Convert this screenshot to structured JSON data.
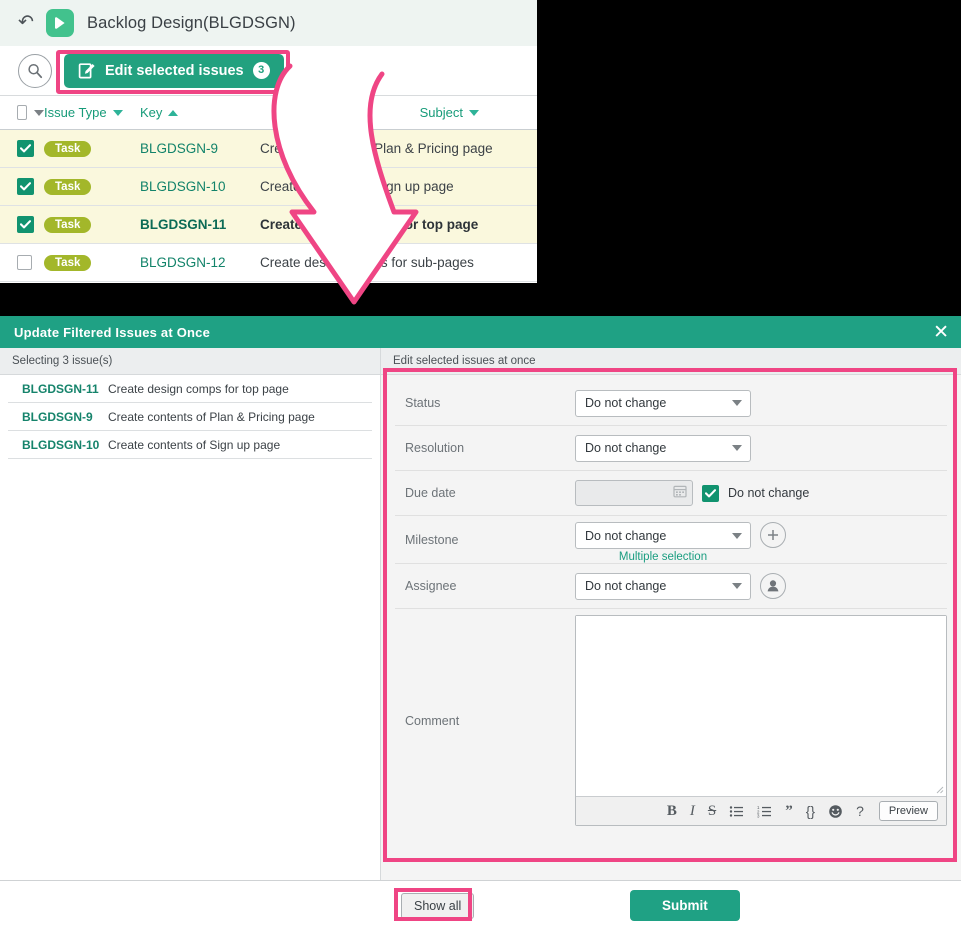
{
  "app": {
    "back_icon": "back-arrow-icon",
    "logo_icon": "backlog-logo-icon",
    "title": "Backlog Design(BLGDSGN)",
    "search_icon": "search-icon",
    "edit_button": {
      "label": "Edit selected issues",
      "count": "3",
      "icon": "edit-document-icon"
    }
  },
  "issue_table": {
    "headers": {
      "checkbox": "",
      "issue_type": "Issue Type",
      "key": "Key",
      "subject": "Subject"
    },
    "rows": [
      {
        "checked": "true",
        "type": "Task",
        "key": "BLGDSGN-9",
        "subject": "Create contents of Plan & Pricing page"
      },
      {
        "checked": "true",
        "type": "Task",
        "key": "BLGDSGN-10",
        "subject": "Create contents of Sign up page"
      },
      {
        "checked": "true",
        "type": "Task",
        "key": "BLGDSGN-11",
        "subject": "Create design comps for top page"
      },
      {
        "checked": "false",
        "type": "Task",
        "key": "BLGDSGN-12",
        "subject": "Create design comps for sub-pages"
      }
    ]
  },
  "dialog": {
    "title": "Update Filtered Issues at Once",
    "close_icon": "close-icon",
    "left": {
      "subheader": "Selecting 3 issue(s)",
      "items": [
        {
          "key": "BLGDSGN-11",
          "subject": "Create design comps for top page"
        },
        {
          "key": "BLGDSGN-9",
          "subject": "Create contents of Plan & Pricing page"
        },
        {
          "key": "BLGDSGN-10",
          "subject": "Create contents of Sign up page"
        }
      ]
    },
    "right": {
      "subheader": "Edit selected issues at once",
      "fields": {
        "status": {
          "label": "Status",
          "value": "Do not change"
        },
        "resolution": {
          "label": "Resolution",
          "value": "Do not change"
        },
        "due_date": {
          "label": "Due date",
          "value": "",
          "checkbox_label": "Do not change",
          "checked": "true",
          "calendar_icon": "calendar-icon"
        },
        "milestone": {
          "label": "Milestone",
          "value": "Do not change",
          "helper": "Multiple selection",
          "add_icon": "plus-icon"
        },
        "assignee": {
          "label": "Assignee",
          "value": "Do not change",
          "avatar_icon": "user-silhouette-icon"
        },
        "comment": {
          "label": "Comment",
          "value": "",
          "placeholder": ""
        }
      },
      "comment_toolbar": {
        "bold": "B",
        "italic": "I",
        "strike": "S",
        "bullet_list": "bullet-list-icon",
        "ordered_list": "ordered-list-icon",
        "quote": "”",
        "code": "{}",
        "emoji": "☺",
        "help": "?",
        "preview": "Preview"
      }
    },
    "footer": {
      "show_all": "Show all",
      "submit": "Submit"
    }
  },
  "annotations": {
    "arrow": "pink-curved-arrow",
    "highlight_edit_button": "pink-highlight-box",
    "highlight_form": "pink-highlight-box",
    "highlight_show_all": "pink-highlight-box"
  },
  "colors": {
    "brand_green": "#1fa184",
    "logo_green": "#42c28d",
    "accent_pink": "#ef4584",
    "task_pill": "#a3b72a",
    "selected_row": "#faf8dd",
    "link_green": "#12836a"
  }
}
